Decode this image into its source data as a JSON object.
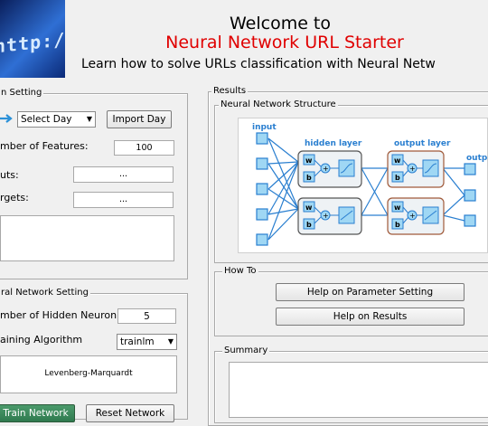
{
  "header": {
    "logo_text": "http://w",
    "title_line1": "Welcome to",
    "title_line2": "Neural Network URL Starter",
    "title_line3": "Learn how to solve URLs classification with Neural Netw"
  },
  "data_setting": {
    "title": "n Setting",
    "select_day": {
      "value": "Select Day"
    },
    "import_day_label": "Import Day",
    "num_features_label": "mber of Features:",
    "num_features_value": "100",
    "inputs_label": "uts:",
    "inputs_value": "...",
    "targets_label": "rgets:",
    "targets_value": "..."
  },
  "network_setting": {
    "title": "ral Network Setting",
    "hidden_neuron_label": "mber of Hidden Neuron",
    "hidden_neuron_value": "5",
    "training_algorithm_label": "aining Algorithm",
    "training_algorithm_value": "trainlm",
    "algorithm_description": "Levenberg-Marquardt",
    "train_button": "Train Network",
    "reset_button": "Reset Network"
  },
  "results": {
    "title": "Results",
    "structure_title": "Neural Network Structure",
    "diagram": {
      "input_label": "input",
      "hidden_label": "hidden layer",
      "output_layer_label": "output layer",
      "output_label": "outp",
      "w_label": "w",
      "b_label": "b",
      "plus_label": "+"
    },
    "howto_title": "How To",
    "help_parameter_button": "Help on Parameter Setting",
    "help_results_button": "Help on Results",
    "summary_title": "Summary"
  },
  "colors": {
    "title_red": "#e00000",
    "diagram_blue": "#2a7fd0",
    "train_green": "#3b8a5c"
  }
}
